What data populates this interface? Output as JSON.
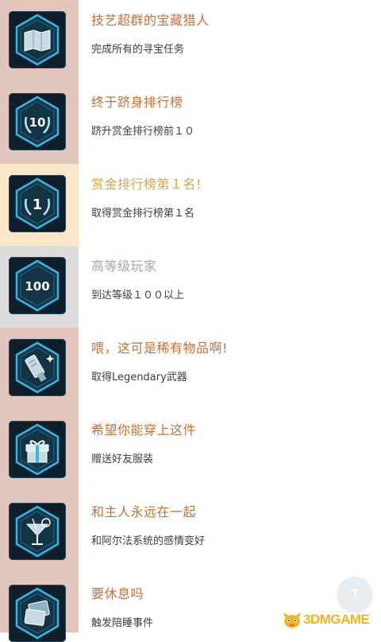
{
  "achievements": [
    {
      "title": "技艺超群的宝藏猎人",
      "desc": "完成所有的寻宝任务",
      "icon": "treasure-map-icon",
      "state": "normal"
    },
    {
      "title": "终于跻身排行榜",
      "desc": "跻升赏金排行榜前１０",
      "icon": "laurel-10-icon",
      "icon_text": "10",
      "state": "normal"
    },
    {
      "title": "赏金排行榜第１名!",
      "desc": "取得赏金排行榜第１名",
      "icon": "laurel-1-icon",
      "icon_text": "1",
      "state": "gold"
    },
    {
      "title": "高等级玩家",
      "desc": "到达等级１００以上",
      "icon": "level-100-icon",
      "icon_text": "100",
      "state": "gray"
    },
    {
      "title": "喂，这可是稀有物品啊!",
      "desc": "取得Legendary武器",
      "icon": "legendary-gun-icon",
      "state": "normal"
    },
    {
      "title": "希望你能穿上这件",
      "desc": "赠送好友服装",
      "icon": "gift-box-icon",
      "state": "normal"
    },
    {
      "title": "和主人永远在一起",
      "desc": "和阿尔法系统的感情变好",
      "icon": "cocktail-glass-icon",
      "state": "normal"
    },
    {
      "title": "要休息吗",
      "desc": "触发陪睡事件",
      "icon": "cards-icon",
      "state": "normal"
    }
  ],
  "floating_button": {
    "label": "T"
  },
  "watermark": {
    "text": "3DMGAME",
    "icon": "mascot-icon"
  },
  "colors": {
    "title": "#c86f37",
    "title_gold": "#d4a650",
    "title_gray": "#a6a6a6",
    "stripe": "#e2c6bd",
    "stripe_gold": "#fbe6c8",
    "stripe_gray": "#dcdcdc",
    "badge_bg": "#0e1f2b",
    "badge_glow": "#37b6e6"
  }
}
